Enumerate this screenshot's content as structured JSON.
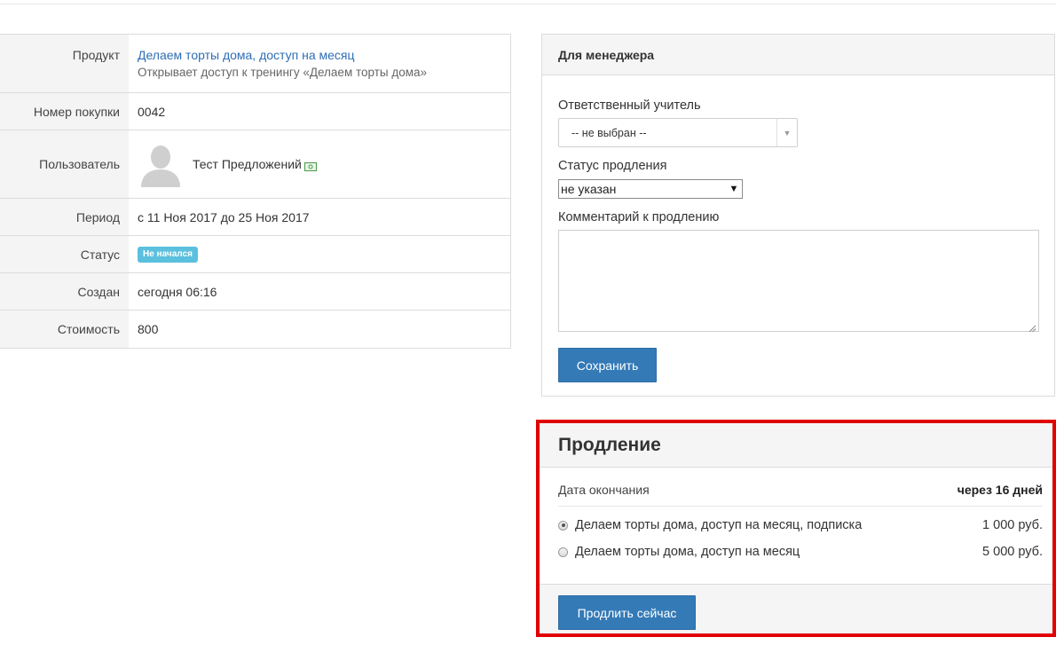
{
  "info": {
    "product_label": "Продукт",
    "product_name": "Делаем торты дома, доступ на месяц",
    "product_desc": "Открывает доступ к тренингу «Делаем торты дома»",
    "number_label": "Номер покупки",
    "number_value": "0042",
    "user_label": "Пользователь",
    "user_name": "Тест Предложений",
    "period_label": "Период",
    "period_value": "с 11 Ноя 2017 до 25 Ноя 2017",
    "status_label": "Статус",
    "status_badge": "Не начался",
    "created_label": "Создан",
    "created_value": "сегодня 06:16",
    "cost_label": "Стоимость",
    "cost_value": "800"
  },
  "manager": {
    "title": "Для менеджера",
    "teacher_label": "Ответственный учитель",
    "teacher_value": "-- не выбран --",
    "renew_status_label": "Статус продления",
    "renew_status_value": "не указан",
    "comment_label": "Комментарий к продлению",
    "comment_value": "",
    "save_label": "Сохранить"
  },
  "renewal": {
    "title": "Продление",
    "end_label": "Дата окончания",
    "end_value": "через 16 дней",
    "options": [
      {
        "label": "Делаем торты дома, доступ на месяц, подписка",
        "price": "1 000 руб.",
        "selected": true
      },
      {
        "label": "Делаем торты дома, доступ на месяц",
        "price": "5 000 руб.",
        "selected": false
      }
    ],
    "renew_label": "Продлить сейчас"
  },
  "colors": {
    "link": "#2f6db5",
    "button": "#337ab7",
    "badge": "#5bc0de",
    "highlight_border": "#e00000"
  }
}
